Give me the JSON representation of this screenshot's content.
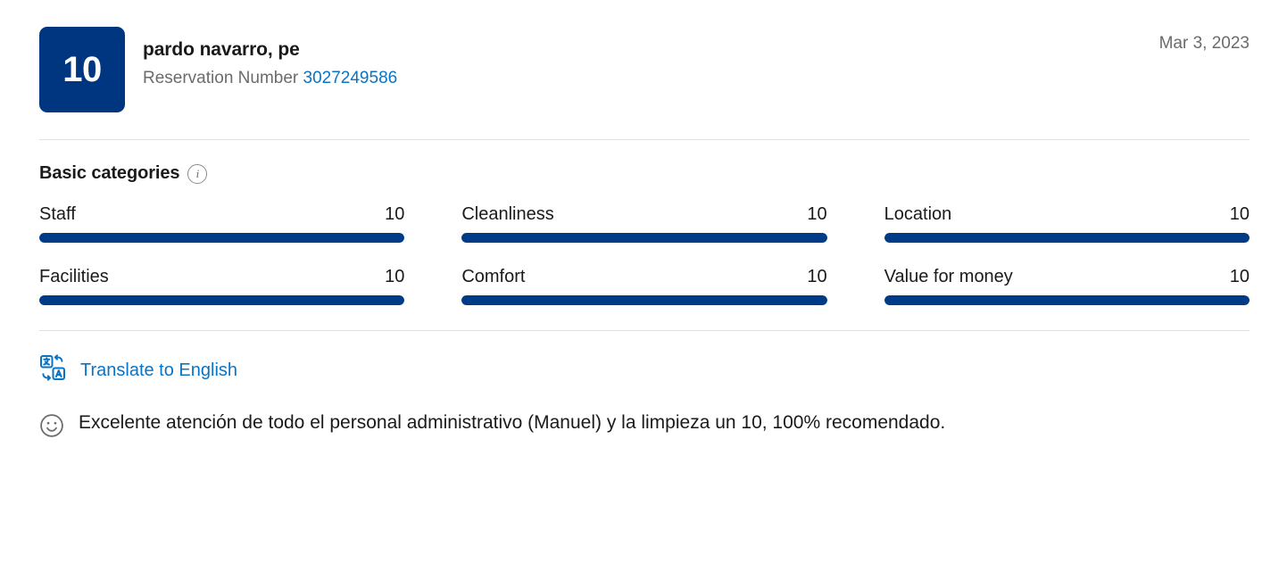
{
  "header": {
    "score_badge": "10",
    "guest_name": "pardo navarro, pe",
    "reservation_label": "Reservation Number",
    "reservation_number": "3027249586",
    "date": "Mar 3, 2023"
  },
  "categories_section": {
    "title": "Basic categories",
    "info_icon": "info-icon",
    "info_glyph": "i",
    "items": [
      {
        "label": "Staff",
        "score": "10",
        "percent": 100
      },
      {
        "label": "Cleanliness",
        "score": "10",
        "percent": 100
      },
      {
        "label": "Location",
        "score": "10",
        "percent": 100
      },
      {
        "label": "Facilities",
        "score": "10",
        "percent": 100
      },
      {
        "label": "Comfort",
        "score": "10",
        "percent": 100
      },
      {
        "label": "Value for money",
        "score": "10",
        "percent": 100
      }
    ]
  },
  "translate": {
    "icon": "translate-icon",
    "label": "Translate to English"
  },
  "review": {
    "icon": "smiley-face-icon",
    "text": "Excelente atención de todo el personal administrativo (Manuel) y la limpieza un 10, 100% recomendado."
  },
  "colors": {
    "badge_background": "#003580",
    "bar_fill": "#003b87",
    "bar_track": "#e7e7e7",
    "link": "#0a74c4",
    "muted_text": "#6b6b6b",
    "divider": "#e0e0e0"
  }
}
